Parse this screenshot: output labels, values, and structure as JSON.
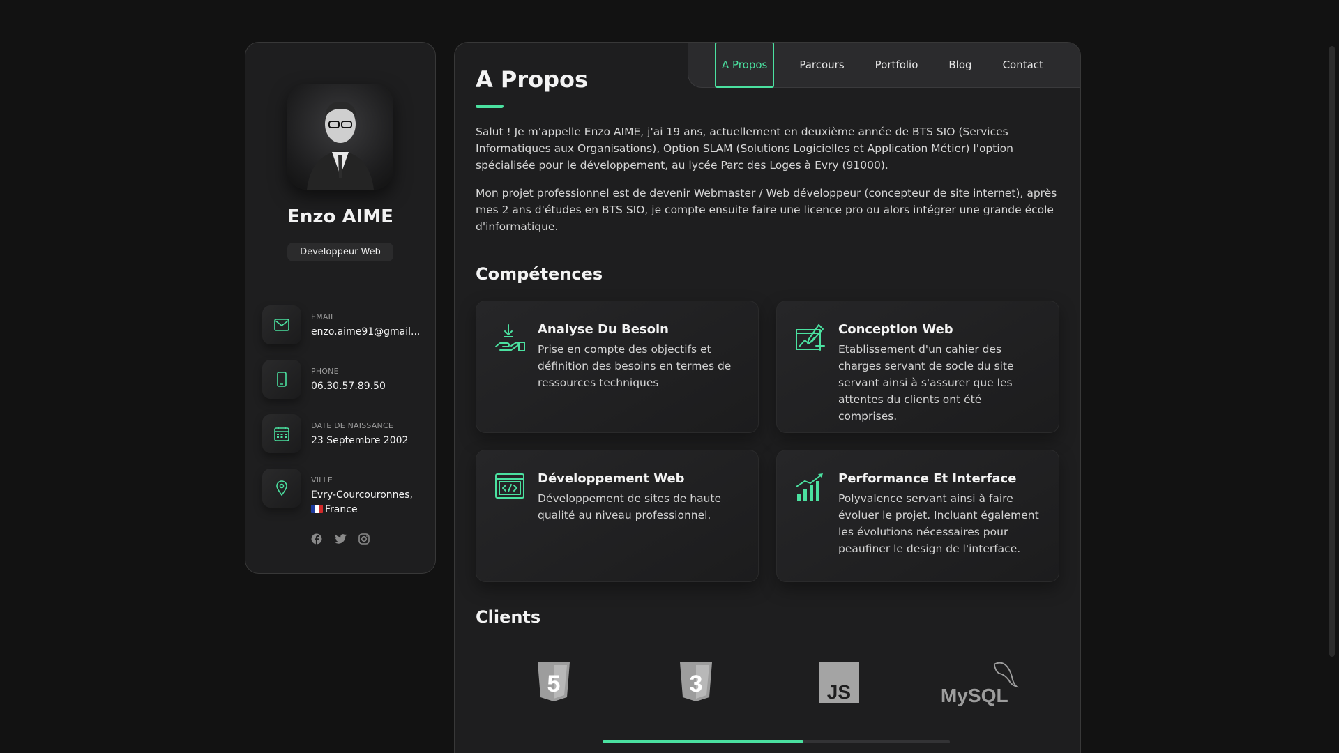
{
  "profile": {
    "name": "Enzo AIME",
    "title": "Developpeur Web",
    "contacts": [
      {
        "label": "Email",
        "value": "enzo.aime91@gmail...",
        "icon": "mail-icon"
      },
      {
        "label": "Phone",
        "value": "06.30.57.89.50",
        "icon": "phone-icon"
      },
      {
        "label": "Date de naissance",
        "value": "23 Septembre 2002",
        "icon": "calendar-icon"
      },
      {
        "label": "Ville",
        "value": "Evry-Courcouronnes,",
        "value2": "France",
        "icon": "location-pin-icon"
      }
    ],
    "socials": [
      "facebook-icon",
      "twitter-icon",
      "instagram-icon"
    ]
  },
  "nav": {
    "items": [
      "A Propos",
      "Parcours",
      "Portfolio",
      "Blog",
      "Contact"
    ],
    "active": "A Propos"
  },
  "about": {
    "title": "A Propos",
    "paragraphs": [
      "Salut ! Je m'appelle Enzo AIME, j'ai 19 ans, actuellement en deuxième année de BTS SIO (Services Informatiques aux Organisations), Option SLAM (Solutions Logicielles et Application Métier) l'option spécialisée pour le développement, au lycée Parc des Loges à Evry (91000).",
      "Mon projet professionnel est de devenir Webmaster / Web développeur (concepteur de site internet), après mes 2 ans d'études en BTS SIO, je compte ensuite faire une licence pro ou alors intégrer une grande école d'informatique."
    ]
  },
  "skills": {
    "title": "Compétences",
    "items": [
      {
        "title": "Analyse Du Besoin",
        "desc": "Prise en compte des objectifs et définition des besoins en termes de ressources techniques",
        "icon": "hand-download-icon"
      },
      {
        "title": "Conception Web",
        "desc": "Etablissement d'un cahier des charges servant de socle du site servant ainsi à s'assurer que les attentes du clients ont été comprises.",
        "icon": "design-pencil-icon"
      },
      {
        "title": "Développement Web",
        "desc": "Développement de sites de haute qualité au niveau professionnel.",
        "icon": "code-window-icon"
      },
      {
        "title": "Performance Et Interface",
        "desc": "Polyvalence servant ainsi à faire évoluer le projet. Incluant également les évolutions nécessaires pour peaufiner le design de l'interface.",
        "icon": "bar-chart-growth-icon"
      }
    ]
  },
  "clients": {
    "title": "Clients",
    "logos": [
      {
        "name": "html5-logo",
        "text": "5"
      },
      {
        "name": "css3-logo",
        "text": "3"
      },
      {
        "name": "javascript-logo",
        "text": "JS"
      },
      {
        "name": "mysql-logo",
        "text": "MySQL"
      }
    ],
    "scroll_progress": 0.58
  },
  "colors": {
    "accent": "#4be1a0",
    "background": "#121212",
    "card": "#1e1e1f"
  }
}
